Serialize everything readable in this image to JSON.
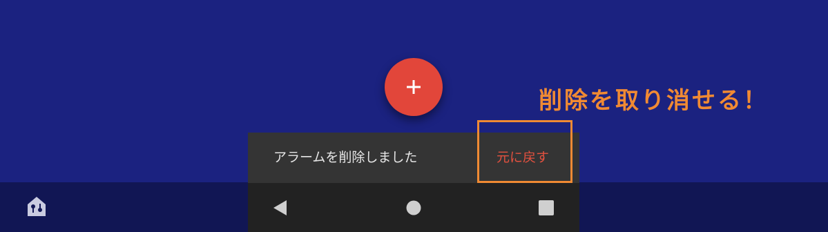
{
  "fab": {
    "icon": "plus-icon",
    "color": "#e2463a"
  },
  "annotation": {
    "text": "削除を取り消せる！",
    "color": "#f08a33"
  },
  "snackbar": {
    "message": "アラームを削除しました",
    "action_label": "元に戻す",
    "action_color": "#e2513f"
  },
  "bottom_bar": {
    "app_icon": "home-icon"
  },
  "navigation": {
    "back": "back-icon",
    "home": "home-circle-icon",
    "recents": "recents-icon"
  },
  "colors": {
    "background": "#1b2280",
    "bottom_bar": "#111654",
    "snackbar": "#343434",
    "nav_bar": "#222222",
    "highlight": "#f08a33"
  }
}
